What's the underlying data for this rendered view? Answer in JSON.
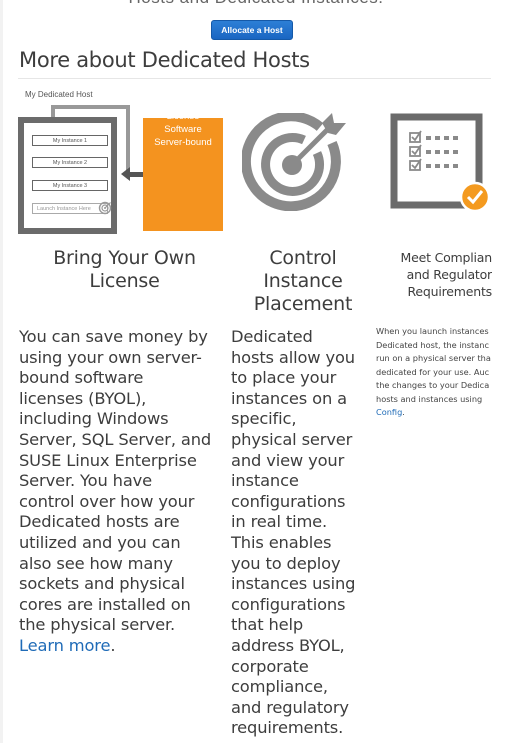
{
  "page": {
    "top_heading": "Hosts and Dedicated Instances.",
    "allocate_button": "Allocate a Host",
    "section_title": "More about Dedicated Hosts"
  },
  "illustrations": {
    "byol": {
      "host_label": "My Dedicated Host",
      "instances": [
        "My Instance 1",
        "My Instance 2",
        "My Instance 3"
      ],
      "launch_slot": "Launch Instance Here",
      "license_lines": [
        "Server-bound",
        "Software",
        "License"
      ]
    },
    "placement": {
      "icon": "target-icon"
    },
    "compliance": {
      "icon": "checklist-icon"
    }
  },
  "columns": [
    {
      "title_lines": [
        "Bring Your Own",
        "License"
      ],
      "body_lines": [
        "You can save money by",
        "using your own server-",
        "bound software",
        "licenses (BYOL),",
        "including Windows",
        "Server, SQL Server, and",
        "SUSE Linux Enterprise",
        "Server. You have",
        "control over how your",
        "Dedicated hosts are",
        "utilized and you can",
        "also see how many",
        "sockets and physical",
        "cores are installed on",
        "the physical server."
      ],
      "link": "Learn more",
      "link_suffix": "."
    },
    {
      "title_lines": [
        "Control",
        "Instance",
        "Placement"
      ],
      "body_lines": [
        "Dedicated",
        "hosts allow you",
        "to place your",
        "instances on a",
        "specific,",
        "physical server",
        "and view your",
        "instance",
        "configurations",
        "in real time.",
        "This enables",
        "you to deploy",
        "instances using",
        "configurations",
        "that help",
        "address BYOL,",
        "corporate",
        "compliance,",
        "and regulatory",
        "requirements."
      ]
    },
    {
      "title_lines": [
        "Meet Complian",
        "and Regulator",
        "Requirements"
      ],
      "body_lines": [
        "When you launch instances",
        "Dedicated host, the instanc",
        "run on a physical server tha",
        "dedicated for your use. Auc",
        "the changes to your Dedica",
        "hosts and instances using"
      ],
      "link": "Config",
      "link_suffix": "."
    }
  ],
  "colors": {
    "accent_blue": "#1a66c2",
    "license_orange": "#f4931f",
    "icon_gray": "#8a8a8a",
    "check_orange": "#f49a1f",
    "link_blue": "#1f6bb7"
  }
}
